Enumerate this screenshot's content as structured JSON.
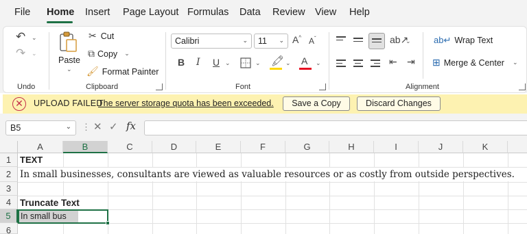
{
  "menu": {
    "items": [
      "File",
      "Home",
      "Insert",
      "Page Layout",
      "Formulas",
      "Data",
      "Review",
      "View",
      "Help"
    ],
    "active": "Home"
  },
  "ribbon": {
    "undo": {
      "label": "Undo"
    },
    "clipboard": {
      "label": "Clipboard",
      "paste": "Paste",
      "cut": "Cut",
      "copy": "Copy",
      "format_painter": "Format Painter"
    },
    "font": {
      "label": "Font",
      "family": "Calibri",
      "size": "11",
      "grow": "A^",
      "shrink": "A^",
      "bold": "B",
      "italic": "I",
      "underline": "U",
      "font_color": "A",
      "highlight_color": "#ffff00",
      "font_color_bar": "#e81123"
    },
    "alignment": {
      "label": "Alignment",
      "wrap_text": "Wrap Text",
      "merge_center": "Merge & Center"
    }
  },
  "notification": {
    "title": "UPLOAD FAILED",
    "message": "The server storage quota has been exceeded.",
    "save_copy": "Save a Copy",
    "discard": "Discard Changes"
  },
  "formula_bar": {
    "name_box": "B5",
    "fx": "fx",
    "value": ""
  },
  "sheet": {
    "columns": [
      "A",
      "B",
      "C",
      "D",
      "E",
      "F",
      "G",
      "H",
      "I",
      "J",
      "K"
    ],
    "rows": [
      "1",
      "2",
      "3",
      "4",
      "5",
      "6"
    ],
    "selected_column": "B",
    "selected_row": "5",
    "cells": {
      "A1": "TEXT",
      "A2": "In small businesses, consultants are viewed as valuable resources or as costly from outside perspectives.",
      "A4": "Truncate Text",
      "A5": "In small bus"
    }
  }
}
